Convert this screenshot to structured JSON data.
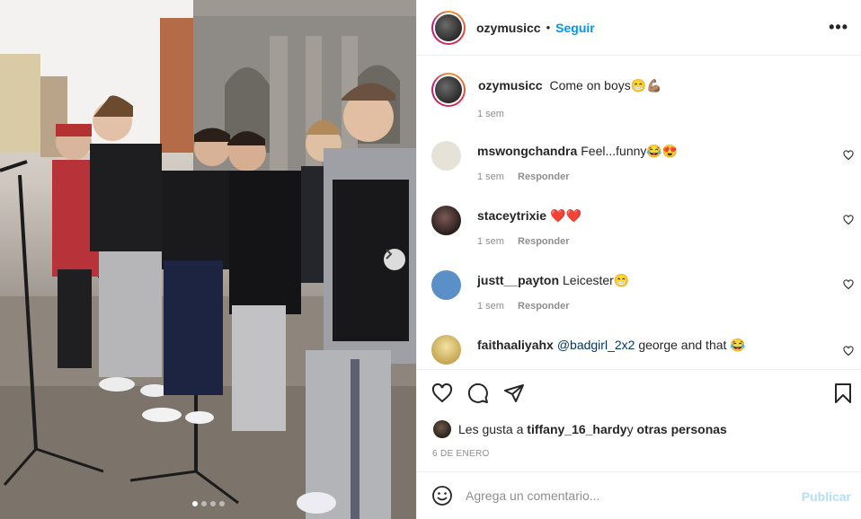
{
  "post": {
    "author": "ozymusicc",
    "follow_label": "Seguir",
    "separator": "•",
    "more_label": "•••",
    "caption": {
      "user": "ozymusicc",
      "text": "Come on boys😁💪🏽",
      "time": "1 sem"
    },
    "carousel": {
      "slide_count": 4,
      "active_index": 0
    }
  },
  "comments": [
    {
      "user": "mswongchandra",
      "text": "Feel...funny😂😍",
      "time": "1 sem",
      "reply_label": "Responder",
      "avatar_color": "#e7e2d8"
    },
    {
      "user": "staceytrixie",
      "text": "❤️❤️",
      "time": "1 sem",
      "reply_label": "Responder",
      "avatar_color": "#3a2d2d"
    },
    {
      "user": "justt__payton",
      "text": "Leicester😁",
      "time": "1 sem",
      "reply_label": "Responder",
      "avatar_color": "#5a8fc7"
    },
    {
      "user": "faithaaliyahx",
      "mention": "@badgirl_2x2",
      "text": " george and that 😂",
      "avatar_color": "#e9d58c"
    }
  ],
  "likes": {
    "prefix": "Les gusta a ",
    "user": "tiffany_16_hardy",
    "middle": " y ",
    "others": "otras personas"
  },
  "date_label": "6 DE ENERO",
  "add_comment": {
    "placeholder": "Agrega un comentario...",
    "publish_label": "Publicar"
  },
  "icons": {
    "header_more": "more-horizontal-icon",
    "like": "heart-icon",
    "comment": "comment-icon",
    "share": "send-icon",
    "save": "bookmark-icon",
    "emoji": "emoji-icon",
    "next": "chevron-right-icon"
  },
  "colors": {
    "accent": "#0095f6",
    "publish_disabled": "#b2dffc",
    "muted": "#8e8e8e"
  }
}
